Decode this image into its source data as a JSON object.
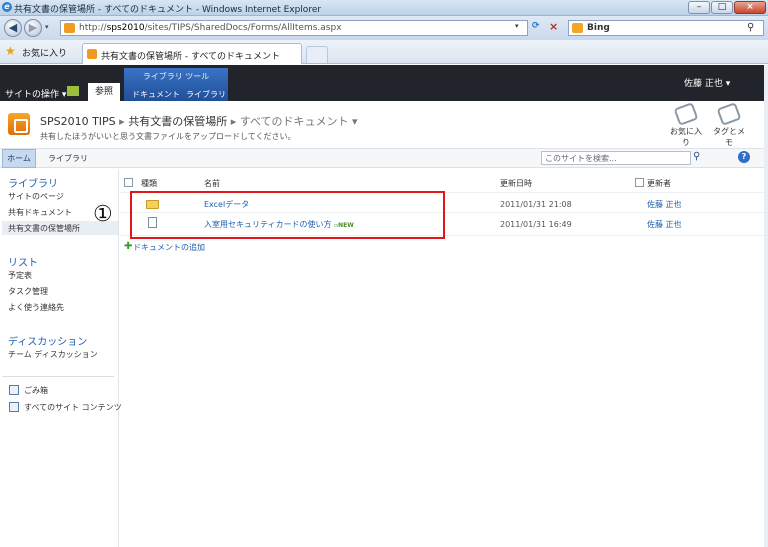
{
  "window": {
    "title": "共有文書の保管場所 - すべてのドキュメント - Windows Internet Explorer",
    "controls": [
      "–",
      "□",
      "×"
    ]
  },
  "address_bar": {
    "url_prefix": "http://",
    "url_host": "sps2010",
    "url_path": "/sites/TIPS/SharedDocs/Forms/AllItems.aspx",
    "search_engine": "Bing",
    "refresh_icon": "⁴⁄",
    "stop_icon": "×"
  },
  "favorites_bar": {
    "label": "お気に入り",
    "tab_title": "共有文書の保管場所 - すべてのドキュメント"
  },
  "ribbon": {
    "site_actions": "サイトの操作 ▾",
    "browse_tab": "参照",
    "library_tools": "ライブラリ ツール",
    "documents_tab": "ドキュメント",
    "library_tab": "ライブラリ",
    "user": "佐藤 正也 ▾"
  },
  "header": {
    "site": "SPS2010 TIPS",
    "separator": "▸",
    "library": "共有文書の保管場所",
    "view": "すべてのドキュメント ▾",
    "description": "共有したほうがいいと思う文書ファイルをアップロードしてください。",
    "favorites_button": "お気に入り",
    "tags_button": "タグとメモ"
  },
  "top_nav": {
    "home": "ホーム",
    "libraries": "ライブラリ",
    "search_placeholder": "このサイトを検索..."
  },
  "left_nav": {
    "libraries_heading": "ライブラリ",
    "site_pages": "サイトのページ",
    "shared_documents": "共有ドキュメント",
    "shared_storage": "共有文書の保管場所",
    "lists_heading": "リスト",
    "calendar": "予定表",
    "tasks": "タスク管理",
    "contacts": "よく使う連絡先",
    "discussions_heading": "ディスカッション",
    "team_discussion": "チーム ディスカッション",
    "recycle_bin": "ごみ箱",
    "all_site_content": "すべてのサイト コンテンツ"
  },
  "list": {
    "headers": {
      "type": "種類",
      "name": "名前",
      "modified": "更新日時",
      "modified_by": "更新者"
    },
    "rows": [
      {
        "name": "Excelデータ",
        "modified": "2011/01/31 21:08",
        "modified_by": "佐藤 正也",
        "new": ""
      },
      {
        "name": "入室用セキュリティカードの使い方",
        "modified": "2011/01/31 16:49",
        "modified_by": "佐藤 正也",
        "new": "NEW"
      }
    ],
    "add_document": "ドキュメントの追加",
    "annotation_number": "①"
  }
}
